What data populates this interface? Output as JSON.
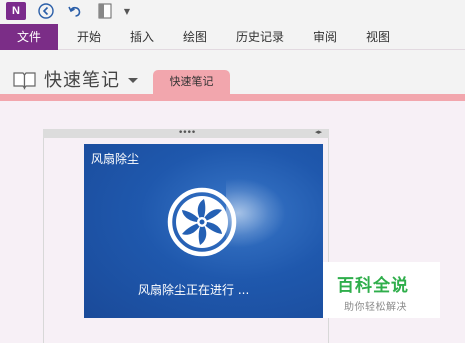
{
  "qat": {
    "icons": [
      "onenote-logo",
      "back-icon",
      "undo-icon",
      "dock-icon",
      "more-icon"
    ],
    "logo_text": "N"
  },
  "ribbon": {
    "tabs": [
      {
        "label": "文件"
      },
      {
        "label": "开始"
      },
      {
        "label": "插入"
      },
      {
        "label": "绘图"
      },
      {
        "label": "历史记录"
      },
      {
        "label": "审阅"
      },
      {
        "label": "视图"
      }
    ]
  },
  "notebook": {
    "name": "快速笔记",
    "section_tab": "快速笔记"
  },
  "page": {
    "container_grip": "••••",
    "container_arrows": "◂▸",
    "screenshot": {
      "title": "风扇除尘",
      "status": "风扇除尘正在进行 ..."
    }
  },
  "watermark": {
    "main": "百科全说",
    "sub": "助你轻松解决"
  },
  "colors": {
    "file_tab": "#7b2d87",
    "section": "#f2a6ad",
    "screen_blue": "#1f58ad",
    "watermark_green": "#2fae4b"
  }
}
